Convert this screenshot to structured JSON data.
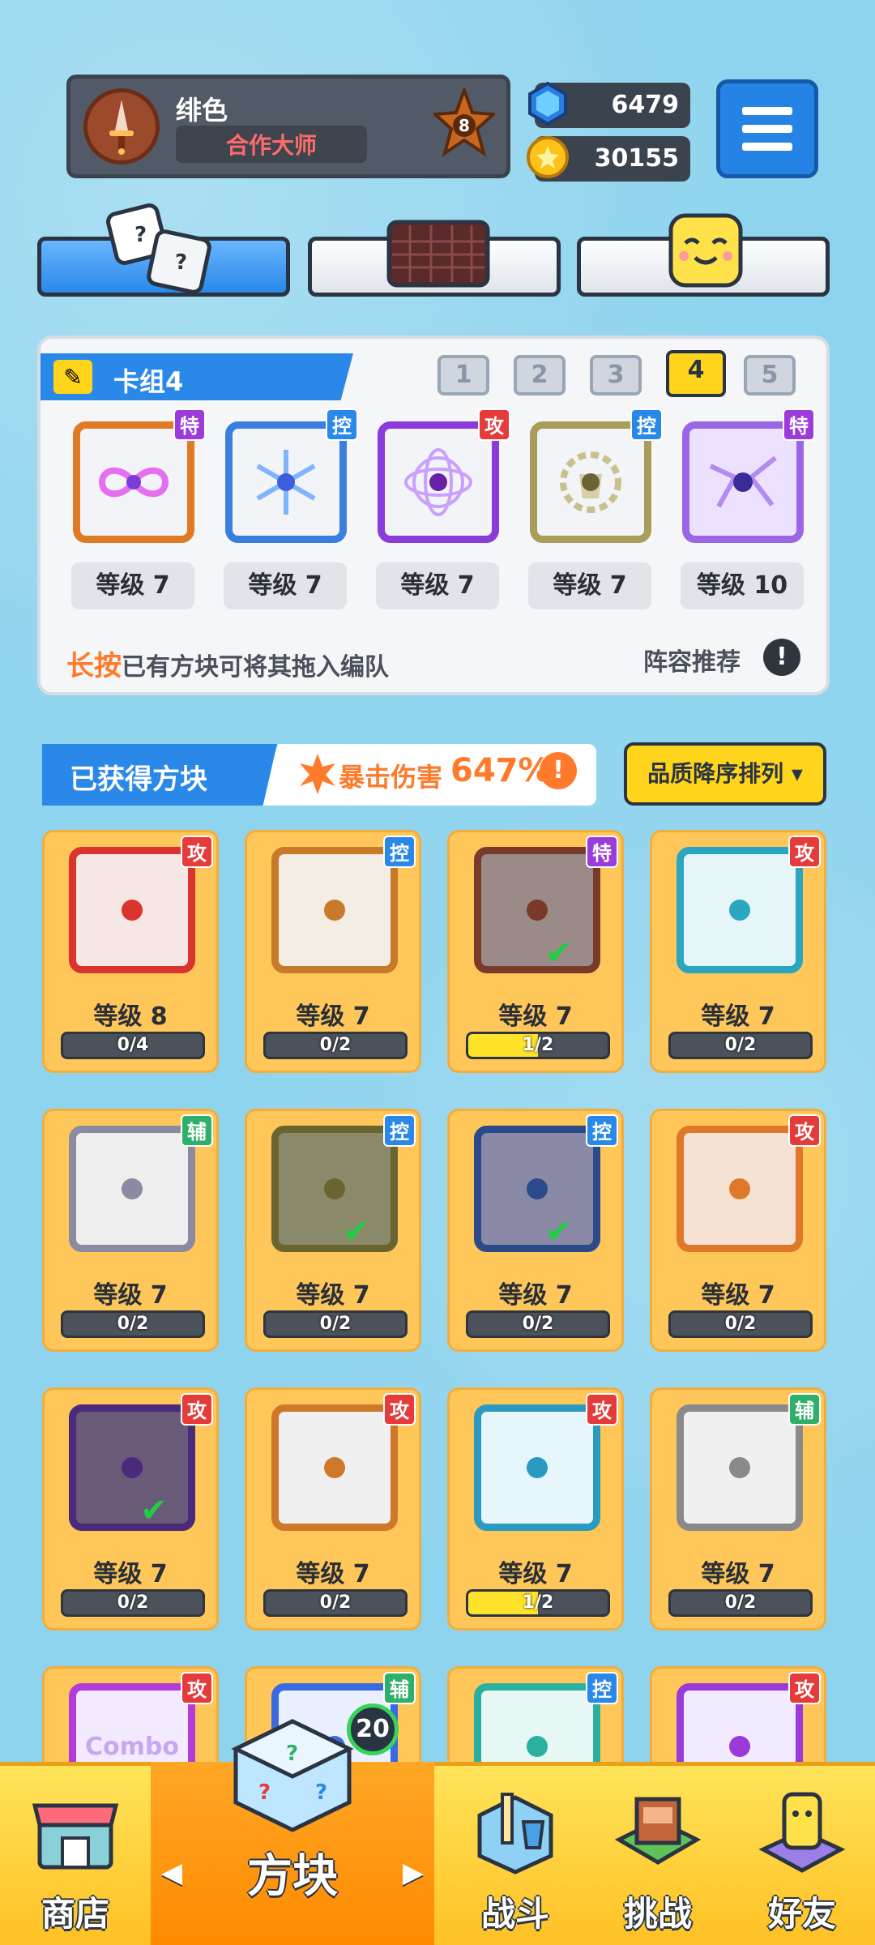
{
  "player": {
    "name": "绯色",
    "title": "合作大师",
    "rank_level": "8",
    "gems": "6479",
    "coins": "30155"
  },
  "colors": {
    "accent_blue": "#2a88e8",
    "gold": "#ffd51c",
    "attack": "#e53b3b",
    "control": "#2a88e8",
    "special": "#9b3bd9",
    "support": "#2fb06a"
  },
  "deck": {
    "title": "卡组4",
    "numbers": [
      "1",
      "2",
      "3",
      "4",
      "5"
    ],
    "selected": "4",
    "tiles": [
      {
        "type": "特",
        "level": "等级 7",
        "icon": "infinity-icon"
      },
      {
        "type": "控",
        "level": "等级 7",
        "icon": "snowflake-icon"
      },
      {
        "type": "攻",
        "level": "等级 7",
        "icon": "orbit-icon"
      },
      {
        "type": "控",
        "level": "等级 7",
        "icon": "gear-shield-icon"
      },
      {
        "type": "特",
        "level": "等级 10",
        "icon": "crack-icon"
      }
    ],
    "hint_highlight": "长按",
    "hint_rest": "已有方块可将其拖入编队",
    "recommend": "阵容推荐"
  },
  "obtained": {
    "title": "已获得方块",
    "crit_label": "暴击伤害",
    "crit_value": "647%",
    "sort_label": "品质降序排列",
    "cards": [
      {
        "type": "攻",
        "level": "等级 8",
        "progress": "0/4",
        "fill": 0,
        "equipped": false,
        "icon": "burst-icon"
      },
      {
        "type": "控",
        "level": "等级 7",
        "progress": "0/2",
        "fill": 0,
        "equipped": false,
        "icon": "sand-icon"
      },
      {
        "type": "特",
        "level": "等级 7",
        "progress": "1/2",
        "fill": 0.5,
        "equipped": true,
        "icon": "infinity-icon"
      },
      {
        "type": "攻",
        "level": "等级 7",
        "progress": "0/2",
        "fill": 0,
        "equipped": false,
        "icon": "totem-icon"
      },
      {
        "type": "辅",
        "level": "等级 7",
        "progress": "0/2",
        "fill": 0,
        "equipped": false,
        "icon": "trap-icon"
      },
      {
        "type": "控",
        "level": "等级 7",
        "progress": "0/2",
        "fill": 0,
        "equipped": true,
        "icon": "gear-shield-icon"
      },
      {
        "type": "控",
        "level": "等级 7",
        "progress": "0/2",
        "fill": 0,
        "equipped": true,
        "icon": "snowflake-icon"
      },
      {
        "type": "攻",
        "level": "等级 7",
        "progress": "0/2",
        "fill": 0,
        "equipped": false,
        "icon": "flame-icon"
      },
      {
        "type": "攻",
        "level": "等级 7",
        "progress": "0/2",
        "fill": 0,
        "equipped": true,
        "icon": "orbit-icon"
      },
      {
        "type": "攻",
        "level": "等级 7",
        "progress": "0/2",
        "fill": 0,
        "equipped": false,
        "icon": "gun-icon"
      },
      {
        "type": "攻",
        "level": "等级 7",
        "progress": "1/2",
        "fill": 0.5,
        "equipped": false,
        "icon": "vortex-icon"
      },
      {
        "type": "辅",
        "level": "等级 7",
        "progress": "0/2",
        "fill": 0,
        "equipped": false,
        "icon": "dial-icon"
      },
      {
        "type": "攻",
        "label": "Combo",
        "icon": "combo-icon"
      },
      {
        "type": "辅",
        "icon": "dragon-icon"
      },
      {
        "type": "控",
        "icon": "wind-icon"
      },
      {
        "type": "攻",
        "icon": "star-icon"
      }
    ]
  },
  "nav": {
    "shop": "商店",
    "blocks": "方块",
    "battle": "战斗",
    "challenge": "挑战",
    "friends": "好友",
    "blocks_badge": "20",
    "left_arrow": "◀",
    "right_arrow": "▶"
  }
}
